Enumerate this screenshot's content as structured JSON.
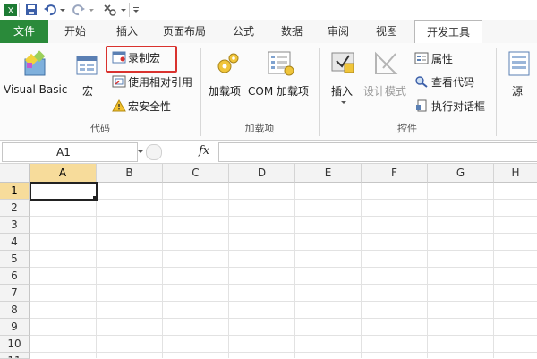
{
  "tabs": [
    "文件",
    "开始",
    "插入",
    "页面布局",
    "公式",
    "数据",
    "审阅",
    "视图",
    "开发工具"
  ],
  "active_tab": "开发工具",
  "ribbon": {
    "code_group": {
      "label": "代码",
      "visual_basic": "Visual Basic",
      "macro": "宏",
      "record_macro": "录制宏",
      "relative_ref": "使用相对引用",
      "macro_security": "宏安全性"
    },
    "addins_group": {
      "label": "加载项",
      "addins": "加载项",
      "com_addins": "COM 加载项"
    },
    "controls_group": {
      "label": "控件",
      "insert": "插入",
      "design_mode": "设计模式",
      "properties": "属性",
      "view_code": "查看代码",
      "run_dialog": "执行对话框"
    },
    "source_group": {
      "source": "源"
    }
  },
  "formula_bar": {
    "name_box": "A1",
    "fx": "fx"
  },
  "grid": {
    "columns": [
      "A",
      "B",
      "C",
      "D",
      "E",
      "F",
      "G",
      "H"
    ],
    "rows": [
      "1",
      "2",
      "3",
      "4",
      "5",
      "6",
      "7",
      "8",
      "9",
      "10",
      "11"
    ],
    "active_cell": "A1"
  },
  "colors": {
    "file_tab": "#2a8a3a",
    "highlight_box": "#d9322e",
    "selection": "#f7dc9b"
  }
}
